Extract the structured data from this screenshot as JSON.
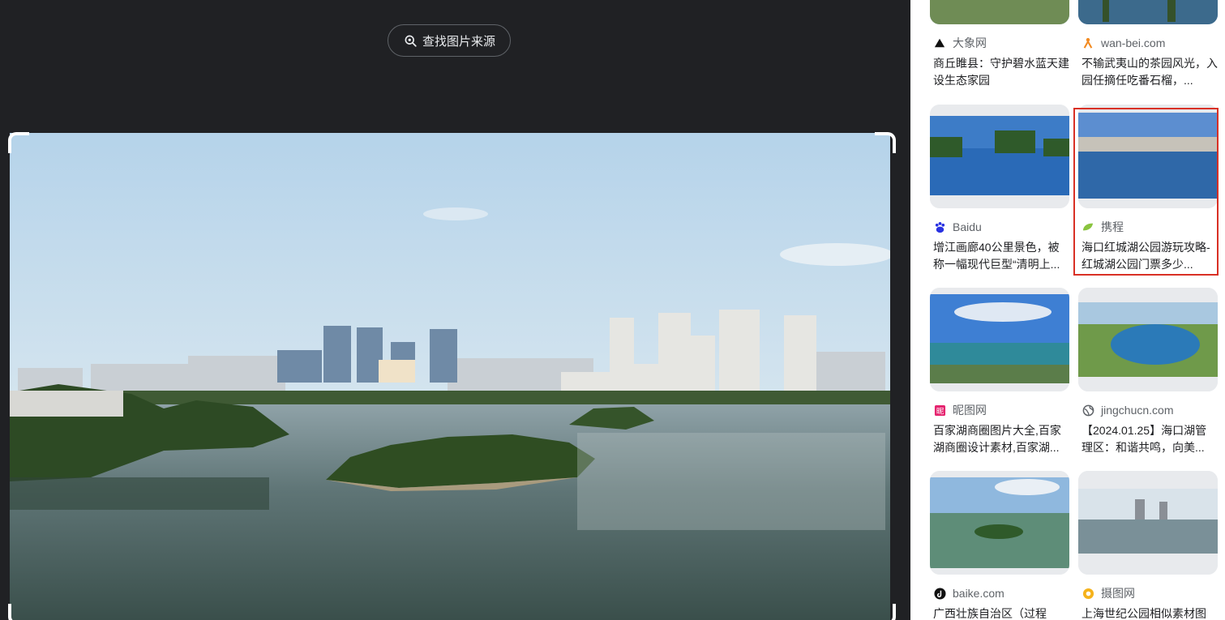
{
  "viewer": {
    "find_source_label": "查找图片来源"
  },
  "results": [
    {
      "source": "大象网",
      "source_icon": "triangle-logo-icon",
      "title": "商丘睢县：守护碧水蓝天建设生态家园"
    },
    {
      "source": "wan-bei.com",
      "source_icon": "person-logo-icon",
      "title": "不输武夷山的茶园风光，入园任摘任吃番石榴，..."
    },
    {
      "source": "Baidu",
      "source_icon": "baidu-paw-icon",
      "title": "增江画廊40公里景色，被称一幅现代巨型“清明上..."
    },
    {
      "source": "携程",
      "source_icon": "ctrip-logo-icon",
      "title": "海口红城湖公园游玩攻略-红城湖公园门票多少..."
    },
    {
      "source": "昵图网",
      "source_icon": "nipic-logo-icon",
      "title": "百家湖商圈图片大全,百家湖商圈设计素材,百家湖..."
    },
    {
      "source": "jingchucn.com",
      "source_icon": "globe-icon",
      "title": "【2024.01.25】海口湖管理区：和谐共鸣，向美..."
    },
    {
      "source": "baike.com",
      "source_icon": "tiktok-logo-icon",
      "title": "广西壮族自治区（过程"
    },
    {
      "source": "摄图网",
      "source_icon": "sheto-logo-icon",
      "title": "上海世纪公园相似素材图"
    }
  ],
  "colors": {
    "viewer_bg": "#202124",
    "highlight": "#d93025"
  }
}
